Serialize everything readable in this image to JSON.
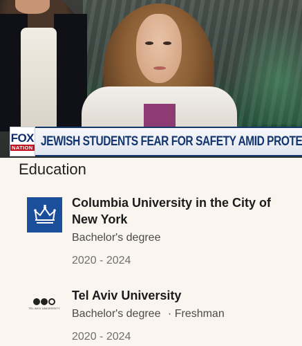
{
  "news": {
    "network_logo_top": "FOX",
    "network_logo_bottom": "NATION",
    "headline": "JEWISH STUDENTS FEAR FOR SAFETY AMID PROTESTS"
  },
  "education": {
    "title": "Education",
    "entries": [
      {
        "school": "Columbia University in the City of New York",
        "degree": "Bachelor's degree",
        "years": "2020 - 2024",
        "logo_icon": "columbia-crown-icon"
      },
      {
        "school": "Tel Aviv University",
        "degree": "Bachelor's degree",
        "extra": "· Freshman",
        "years": "2020 - 2024",
        "logo_icon": "tau-rings-icon",
        "logo_caption": "TEL AVIV UNIVERSITY"
      }
    ]
  },
  "colors": {
    "page_bg": "#fbf5ef",
    "columbia_blue": "#1b4e9b",
    "fox_navy": "#14366e",
    "fox_red": "#c1121f"
  }
}
